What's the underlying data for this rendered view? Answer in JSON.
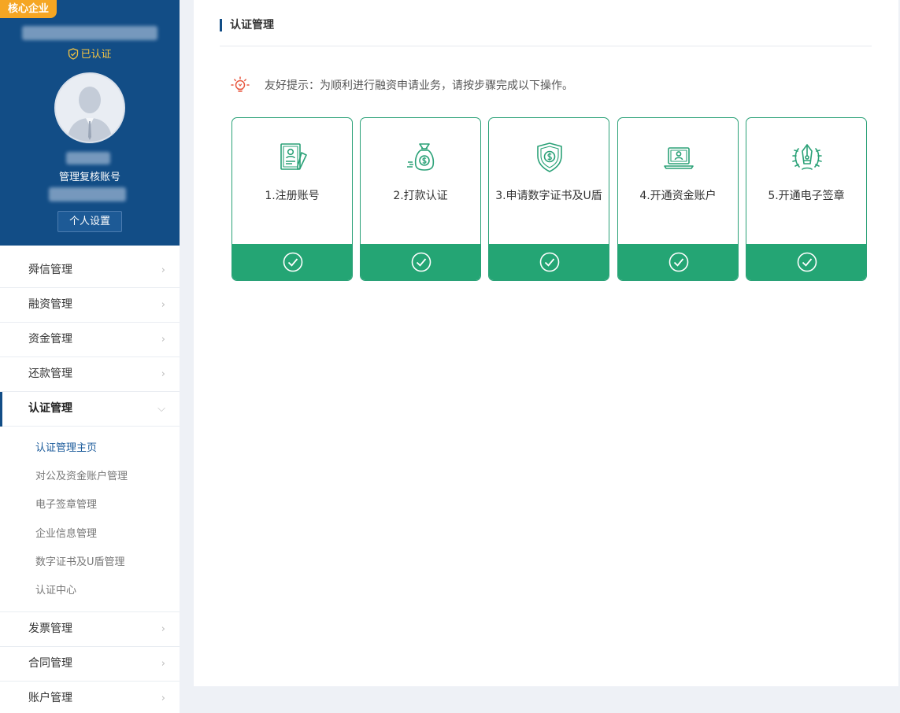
{
  "profile": {
    "badge": "核心企业",
    "verified": "已认证",
    "account_name": "管理复核账号",
    "settings_button": "个人设置"
  },
  "menu": {
    "items": [
      {
        "label": "舜信管理"
      },
      {
        "label": "融资管理"
      },
      {
        "label": "资金管理"
      },
      {
        "label": "还款管理"
      },
      {
        "label": "认证管理"
      }
    ],
    "submenu": [
      {
        "label": "认证管理主页"
      },
      {
        "label": "对公及资金账户管理"
      },
      {
        "label": "电子签章管理"
      },
      {
        "label": "企业信息管理"
      },
      {
        "label": "数字证书及U盾管理"
      },
      {
        "label": "认证中心"
      }
    ],
    "items_after": [
      {
        "label": "发票管理"
      },
      {
        "label": "合同管理"
      },
      {
        "label": "账户管理"
      }
    ]
  },
  "main": {
    "title": "认证管理",
    "tip": "友好提示：为顺利进行融资申请业务，请按步骤完成以下操作。",
    "steps": [
      {
        "label": "1.注册账号",
        "icon": "register-document-icon"
      },
      {
        "label": "2.打款认证",
        "icon": "money-bag-icon"
      },
      {
        "label": "3.申请数字证书及U盾",
        "icon": "certificate-shield-icon"
      },
      {
        "label": "4.开通资金账户",
        "icon": "laptop-account-icon"
      },
      {
        "label": "5.开通电子签章",
        "icon": "seal-pen-icon"
      }
    ]
  },
  "colors": {
    "sidebar_blue": "#124d86",
    "badge_orange": "#f5a623",
    "step_green": "#24a574",
    "icon_green": "#2aa177"
  }
}
